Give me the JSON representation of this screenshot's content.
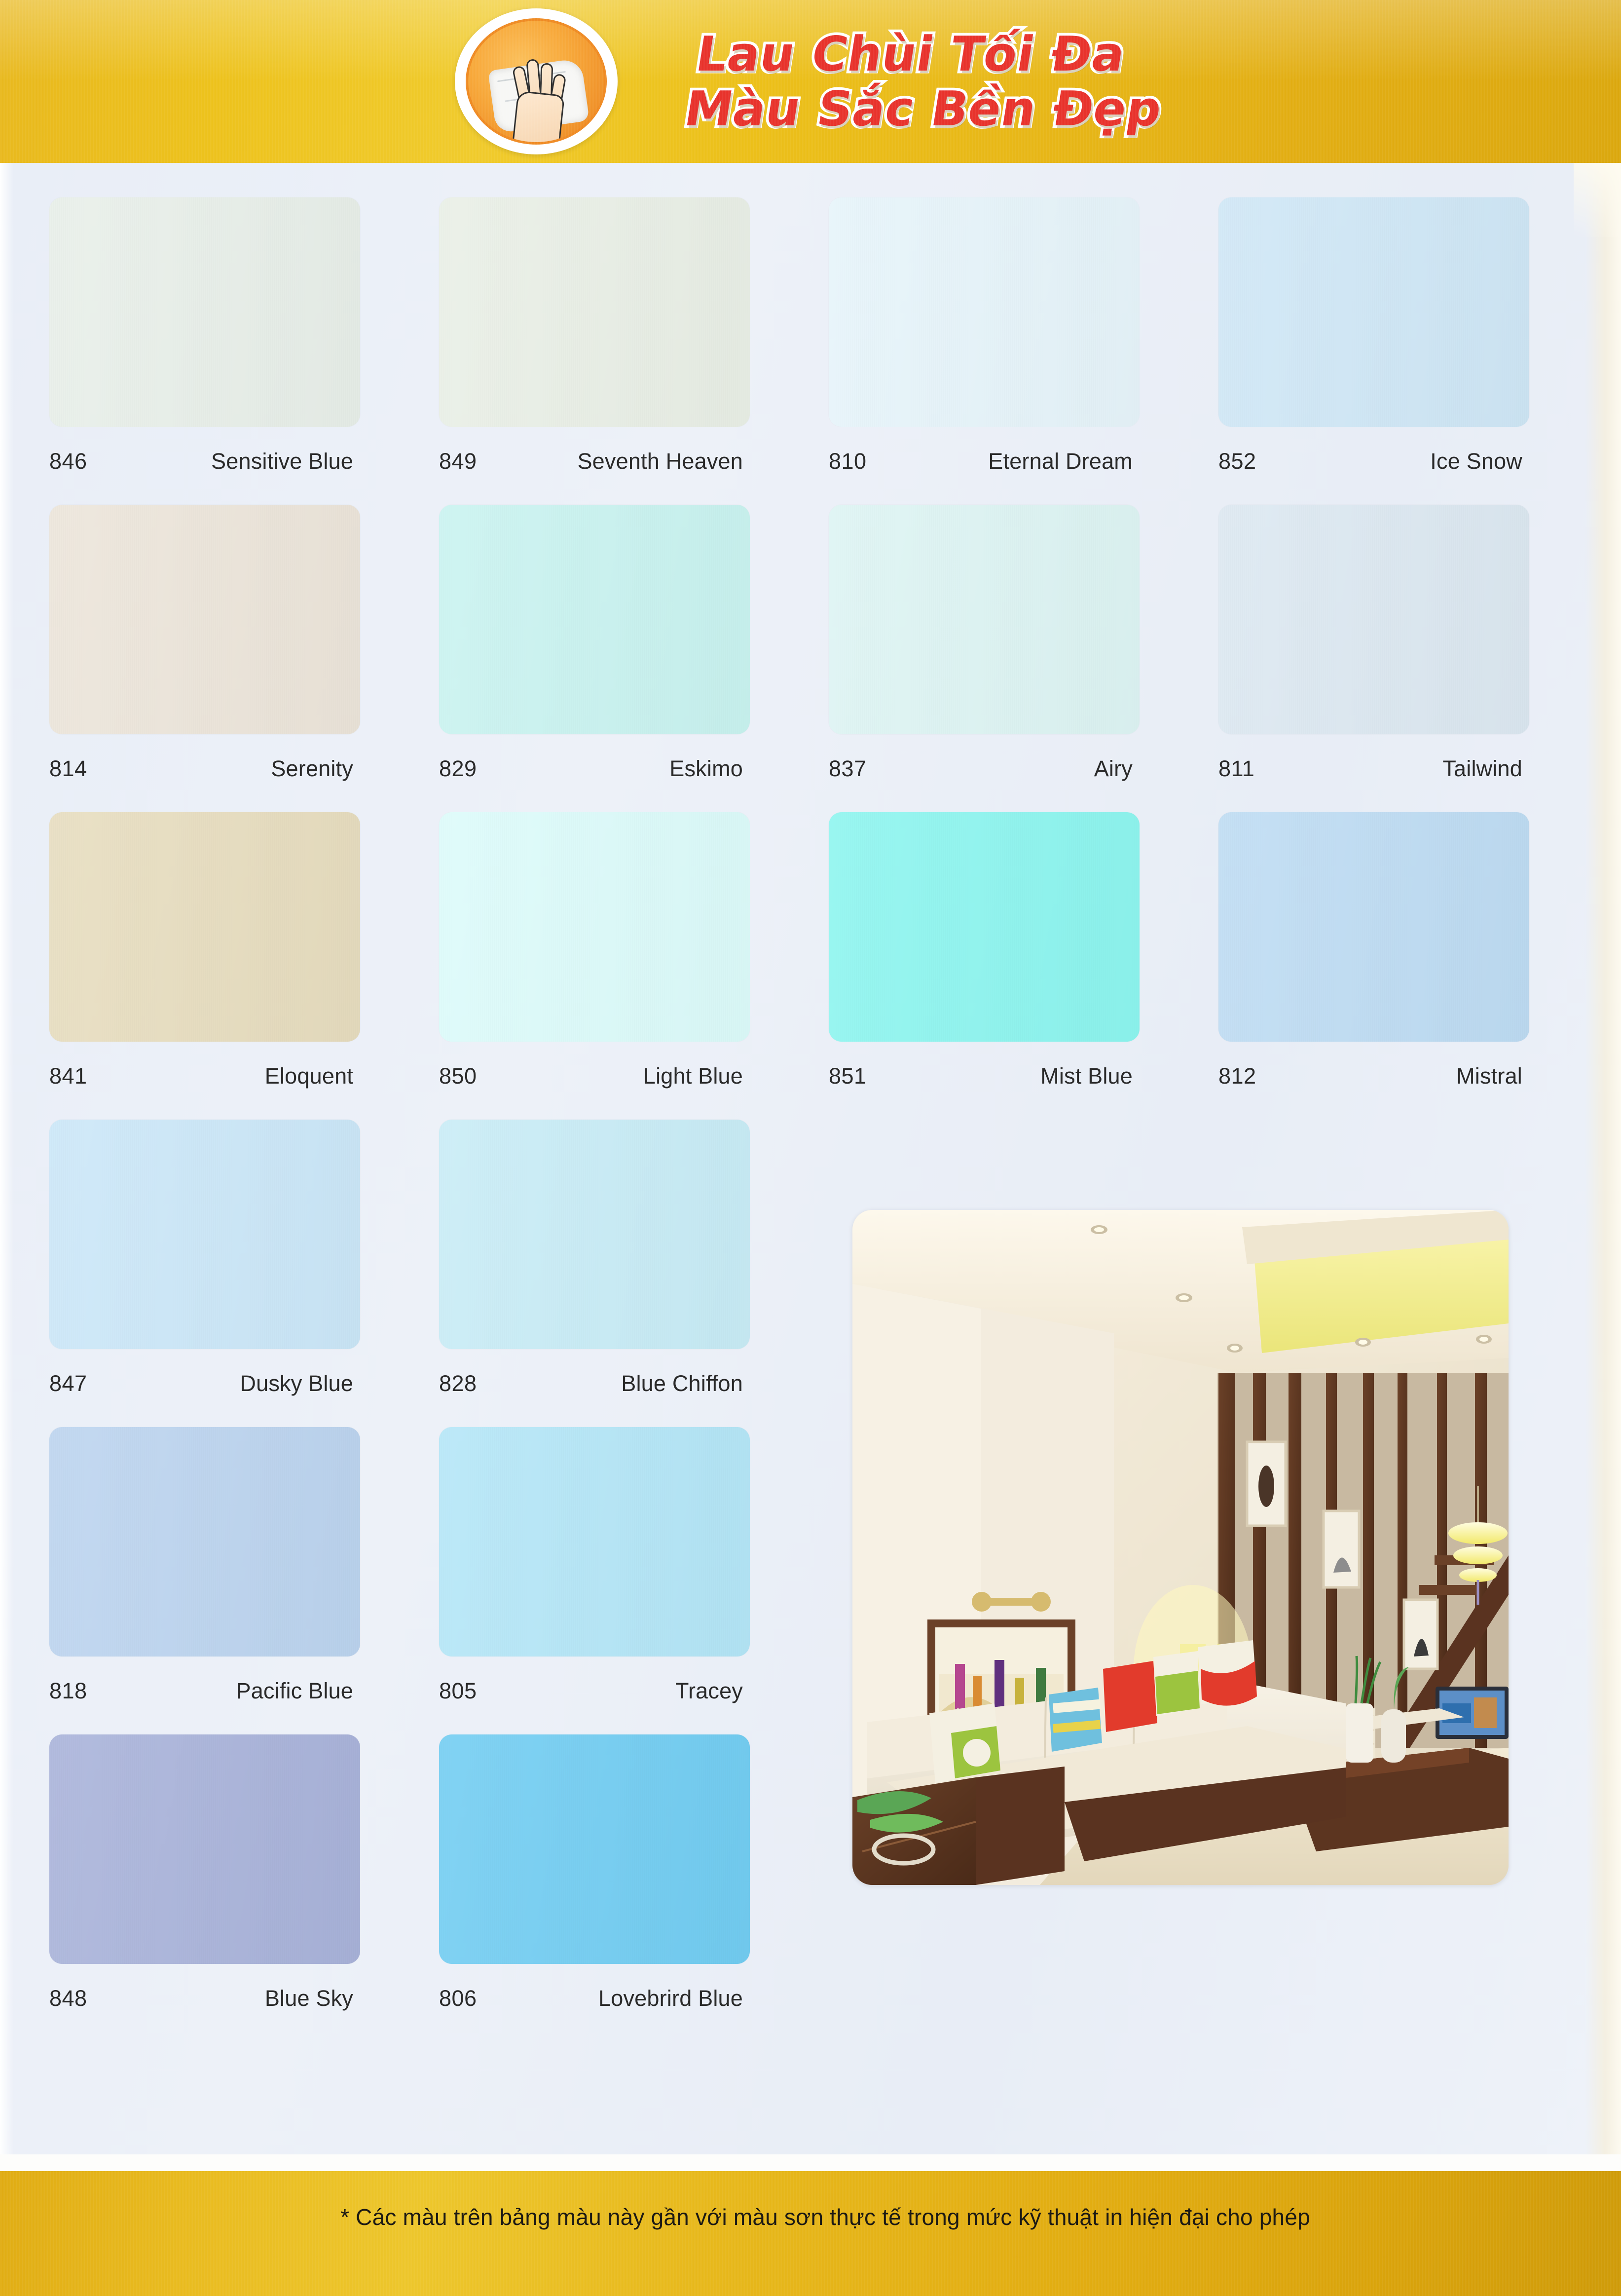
{
  "header": {
    "title_line1": "Lau Chùi Tối Đa",
    "title_line2": "Màu Sắc Bền Đẹp",
    "badge_icon": "hand-wiping-cloth-icon",
    "band_color": "#eabd1e",
    "title_color": "#e8332c",
    "title_outline_color": "#ffffff"
  },
  "swatch_grid": {
    "columns": 4,
    "rows": [
      [
        {
          "code": "846",
          "name": "Sensitive Blue",
          "hex": "#e8efe9"
        },
        {
          "code": "849",
          "name": "Seventh Heaven",
          "hex": "#e9efe6"
        },
        {
          "code": "810",
          "name": "Eternal Dream",
          "hex": "#e6f4fa"
        },
        {
          "code": "852",
          "name": "Ice Snow",
          "hex": "#cfe7f6"
        }
      ],
      [
        {
          "code": "814",
          "name": "Serenity",
          "hex": "#ece5da"
        },
        {
          "code": "829",
          "name": "Eskimo",
          "hex": "#c9f3f0"
        },
        {
          "code": "837",
          "name": "Airy",
          "hex": "#ddf4f3"
        },
        {
          "code": "811",
          "name": "Tailwind",
          "hex": "#dce8f1"
        }
      ],
      [
        {
          "code": "841",
          "name": "Eloquent",
          "hex": "#e7ddbf"
        },
        {
          "code": "850",
          "name": "Light Blue",
          "hex": "#dcfbfa"
        },
        {
          "code": "851",
          "name": "Mist Blue",
          "hex": "#8df5ef"
        },
        {
          "code": "812",
          "name": "Mistral",
          "hex": "#bedcf3"
        }
      ],
      [
        {
          "code": "847",
          "name": "Dusky Blue",
          "hex": "#cbe7f8"
        },
        {
          "code": "828",
          "name": "Blue Chiffon",
          "hex": "#c8ecf6"
        }
      ],
      [
        {
          "code": "818",
          "name": "Pacific Blue",
          "hex": "#bcd4ef"
        },
        {
          "code": "805",
          "name": "Tracey",
          "hex": "#b4e6f7"
        }
      ],
      [
        {
          "code": "848",
          "name": "Blue Sky",
          "hex": "#a9b3da"
        },
        {
          "code": "806",
          "name": "Lovebrird Blue",
          "hex": "#72cdf2"
        }
      ]
    ]
  },
  "room_photo": {
    "alt": "living room interior with cream sofa, colorful cushions, wooden coffee table and shag rug",
    "name": "interior-room-photo"
  },
  "footer": {
    "note": "* Các màu trên bảng màu này gần với màu sơn thực tế trong mức kỹ thuật in hiện đại cho phép",
    "band_color": "#e3b118"
  }
}
